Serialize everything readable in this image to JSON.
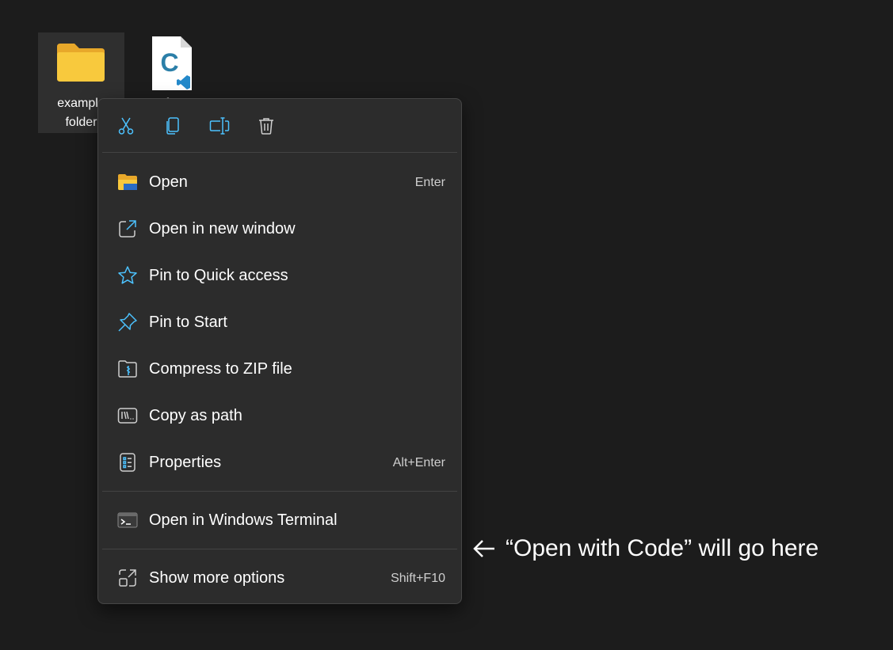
{
  "desktop": {
    "folder_icon": {
      "label": "example\nfolder"
    },
    "c_file_icon": {
      "letter": "C",
      "label": "f..."
    }
  },
  "context_menu": {
    "toolbar": [
      {
        "name": "cut-icon"
      },
      {
        "name": "copy-icon"
      },
      {
        "name": "rename-icon"
      },
      {
        "name": "delete-icon"
      }
    ],
    "items": [
      {
        "label": "Open",
        "shortcut": "Enter",
        "icon": "folder-open-icon"
      },
      {
        "label": "Open in new window",
        "shortcut": "",
        "icon": "new-window-icon"
      },
      {
        "label": "Pin to Quick access",
        "shortcut": "",
        "icon": "star-icon"
      },
      {
        "label": "Pin to Start",
        "shortcut": "",
        "icon": "pin-icon"
      },
      {
        "label": "Compress to ZIP file",
        "shortcut": "",
        "icon": "zip-icon"
      },
      {
        "label": "Copy as path",
        "shortcut": "",
        "icon": "copy-path-icon"
      },
      {
        "label": "Properties",
        "shortcut": "Alt+Enter",
        "icon": "properties-icon"
      },
      {
        "label": "Open in Windows Terminal",
        "shortcut": "",
        "icon": "terminal-icon"
      },
      {
        "label": "Show more options",
        "shortcut": "Shift+F10",
        "icon": "more-options-icon"
      }
    ]
  },
  "annotation": {
    "text": "“Open with Code” will go here"
  },
  "colors": {
    "accent": "#4cc2ff",
    "background": "#1c1c1c",
    "menu": "#2c2c2c",
    "folder": "#f8c93d"
  }
}
